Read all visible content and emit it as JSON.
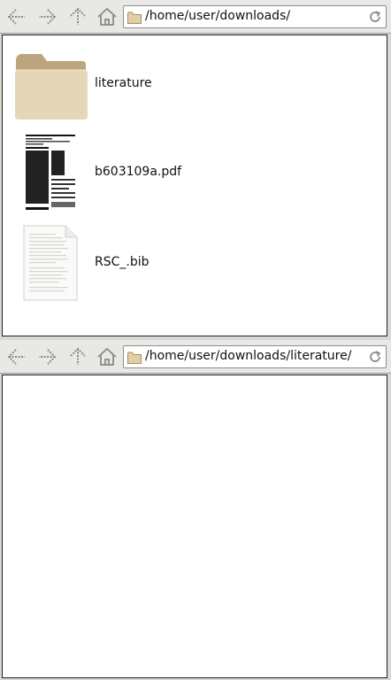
{
  "top_pane": {
    "toolbar": {
      "back_icon": "back-arrow-icon",
      "forward_icon": "forward-arrow-icon",
      "up_icon": "up-arrow-icon",
      "home_icon": "home-icon",
      "location_path": "/home/user/downloads/",
      "reload_icon": "reload-icon"
    },
    "files": [
      {
        "name": "literature",
        "type": "folder",
        "icon": "folder-icon"
      },
      {
        "name": "b603109a.pdf",
        "type": "pdf",
        "icon": "pdf-thumbnail-icon"
      },
      {
        "name": "RSC_.bib",
        "type": "text",
        "icon": "text-file-icon"
      }
    ]
  },
  "bottom_pane": {
    "toolbar": {
      "back_icon": "back-arrow-icon",
      "forward_icon": "forward-arrow-icon",
      "up_icon": "up-arrow-icon",
      "home_icon": "home-icon",
      "location_path": "/home/user/downloads/literature/",
      "reload_icon": "reload-icon"
    },
    "files": []
  },
  "colors": {
    "folder": "#d9c7a3",
    "folder_dark": "#bba57c",
    "toolbar_bg": "#e8e8e7",
    "view_bg": "#ffffff"
  }
}
